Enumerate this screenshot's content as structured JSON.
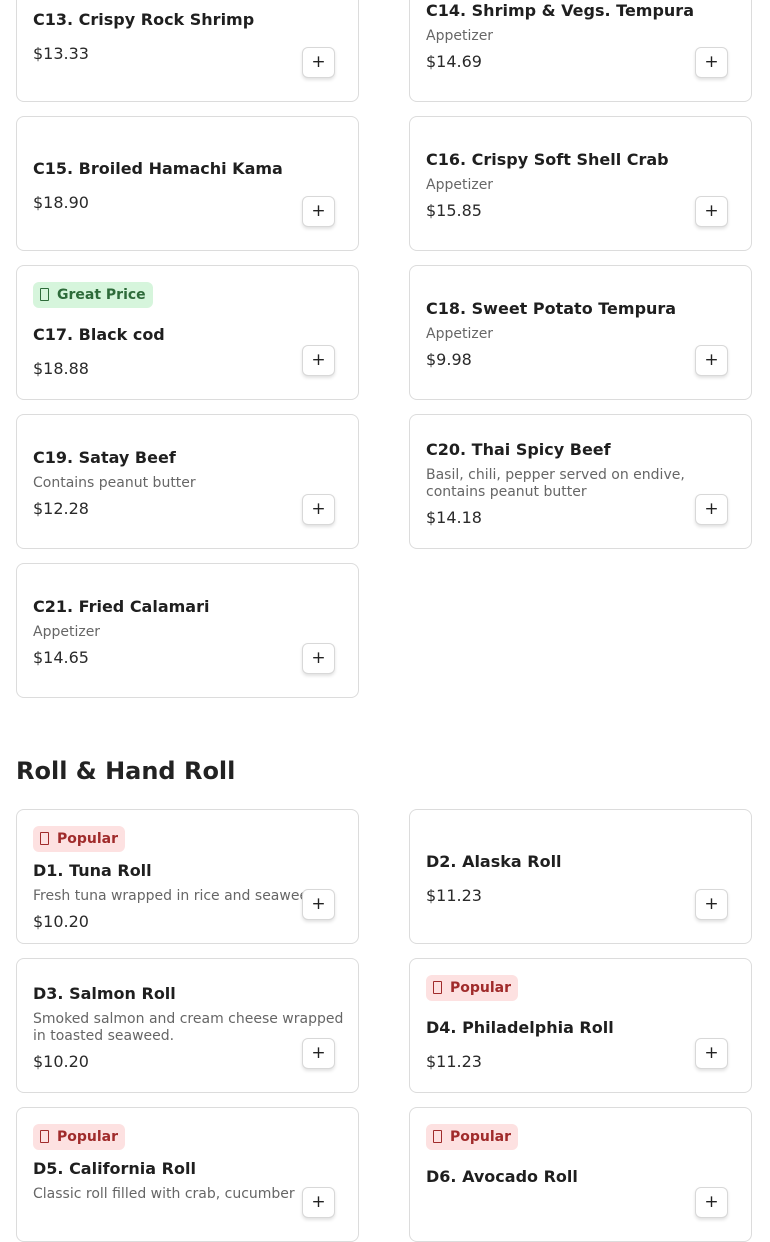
{
  "section": {
    "title": "Roll & Hand Roll"
  },
  "add_symbol": "+",
  "items": [
    {
      "name": "C13. Crispy Rock Shrimp",
      "price": "$13.33"
    },
    {
      "name": "C14. Shrimp & Vegs. Tempura",
      "desc": "Appetizer",
      "price": "$14.69"
    },
    {
      "name": "C15. Broiled Hamachi Kama",
      "price": "$18.90"
    },
    {
      "name": "C16. Crispy Soft Shell Crab",
      "desc": "Appetizer",
      "price": "$15.85"
    },
    {
      "name": "C17. Black cod",
      "price": "$18.88",
      "badge": "Great Price"
    },
    {
      "name": "C18. Sweet Potato Tempura",
      "desc": "Appetizer",
      "price": "$9.98"
    },
    {
      "name": "C19. Satay Beef",
      "desc": "Contains peanut butter",
      "price": "$12.28"
    },
    {
      "name": "C20. Thai Spicy Beef",
      "desc": "Basil, chili, pepper served on endive, contains peanut butter",
      "price": "$14.18"
    },
    {
      "name": "C21. Fried Calamari",
      "desc": "Appetizer",
      "price": "$14.65"
    },
    {
      "name": "D1. Tuna Roll",
      "desc": "Fresh tuna wrapped in rice and seaweed.",
      "price": "$10.20",
      "badge": "Popular"
    },
    {
      "name": "D2. Alaska Roll",
      "price": "$11.23"
    },
    {
      "name": "D3. Salmon Roll",
      "desc": "Smoked salmon and cream cheese wrapped in toasted seaweed.",
      "price": "$10.20"
    },
    {
      "name": "D4. Philadelphia Roll",
      "price": "$11.23",
      "badge": "Popular"
    },
    {
      "name": "D5. California Roll",
      "desc": "Classic roll filled with crab, cucumber",
      "badge": "Popular"
    },
    {
      "name": "D6. Avocado Roll",
      "badge": "Popular"
    }
  ]
}
